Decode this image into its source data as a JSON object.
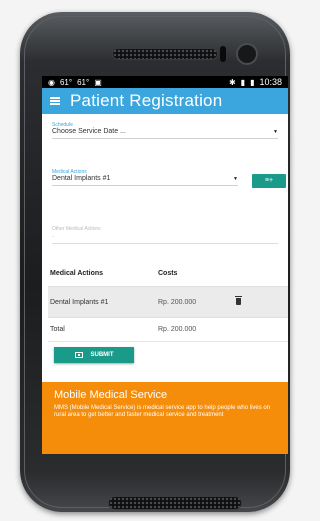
{
  "status_bar": {
    "left_items": [
      "61°",
      "61°"
    ],
    "time": "10:38"
  },
  "app_bar": {
    "title": "Patient Registration",
    "color": "#3aa6dd"
  },
  "form": {
    "schedule": {
      "label": "Schedule",
      "value": "Choose Service Date ..."
    },
    "medical_actions": {
      "label": "Medical Actions",
      "value": "Dental Implants #1"
    },
    "add_button_icon": "add-list-icon",
    "other_medical_actions": {
      "label": "Other Medical Actions",
      "placeholder": "-"
    }
  },
  "table": {
    "headers": [
      "Medical Actions",
      "Costs"
    ],
    "rows": [
      {
        "action": "Dental Implants #1",
        "cost": "Rp. 200.000"
      }
    ],
    "total_label": "Total",
    "total_value": "Rp. 200.000"
  },
  "submit": {
    "label": "SUBMIT",
    "color": "#1a9b8a"
  },
  "footer": {
    "title": "Mobile Medical Service",
    "text": "MMS (Mobile Medical Service) is medical service app to help people who lives on rural area to get better and faster medical service and treatment",
    "color": "#f58d0a"
  }
}
